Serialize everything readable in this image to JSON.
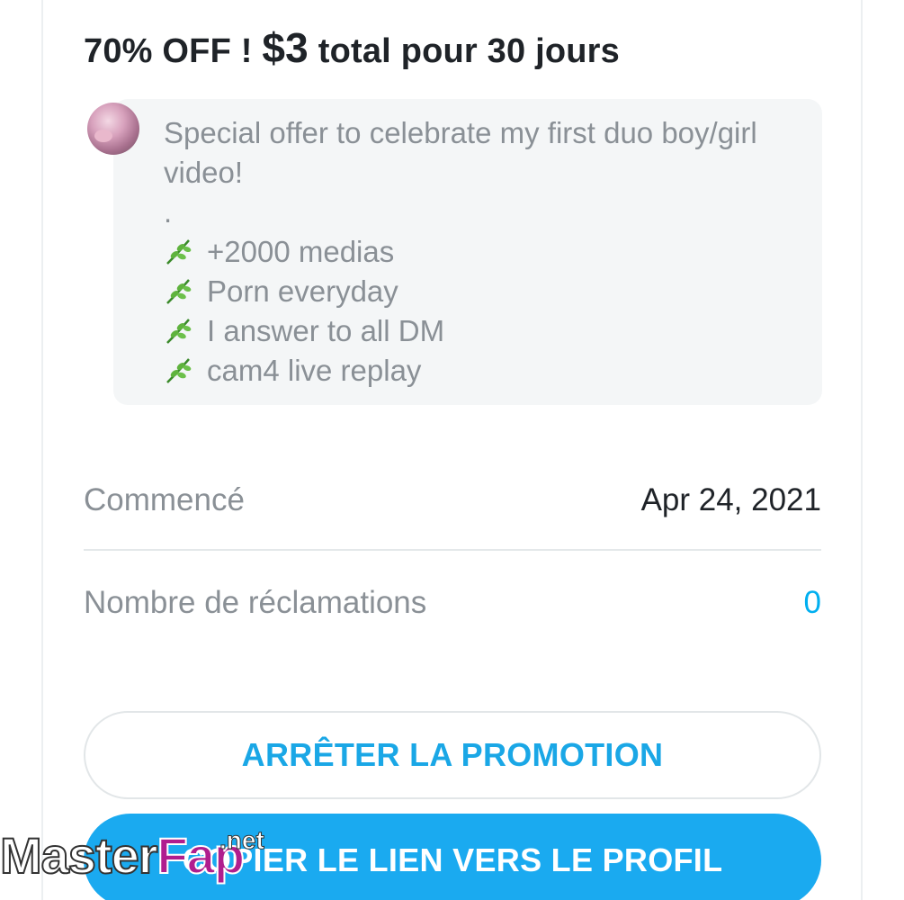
{
  "offer": {
    "title_prefix": "70% OFF !",
    "title_price": "$3",
    "title_suffix": "total pour 30 jours"
  },
  "message": {
    "lines": [
      "Special offer to celebrate my first duo boy/girl",
      "video!",
      "."
    ],
    "bullets": [
      "+2000 medias",
      "Porn everyday",
      "I answer to all DM",
      "cam4 live replay"
    ],
    "bullet_icon": "herb-icon"
  },
  "details": {
    "started_label": "Commencé",
    "started_value": "Apr 24, 2021",
    "claims_label": "Nombre de réclamations",
    "claims_value": "0"
  },
  "buttons": {
    "stop_label": "ARRÊTER LA PROMOTION",
    "copy_label": "COPIER LE LIEN VERS LE PROFIL"
  },
  "watermark": {
    "part1": "Master",
    "part2": "Fap",
    "suffix": ".net"
  },
  "colors": {
    "accent": "#00aff0",
    "text": "#1f2328",
    "muted": "#8a9096",
    "bubble": "#f4f6f7"
  }
}
